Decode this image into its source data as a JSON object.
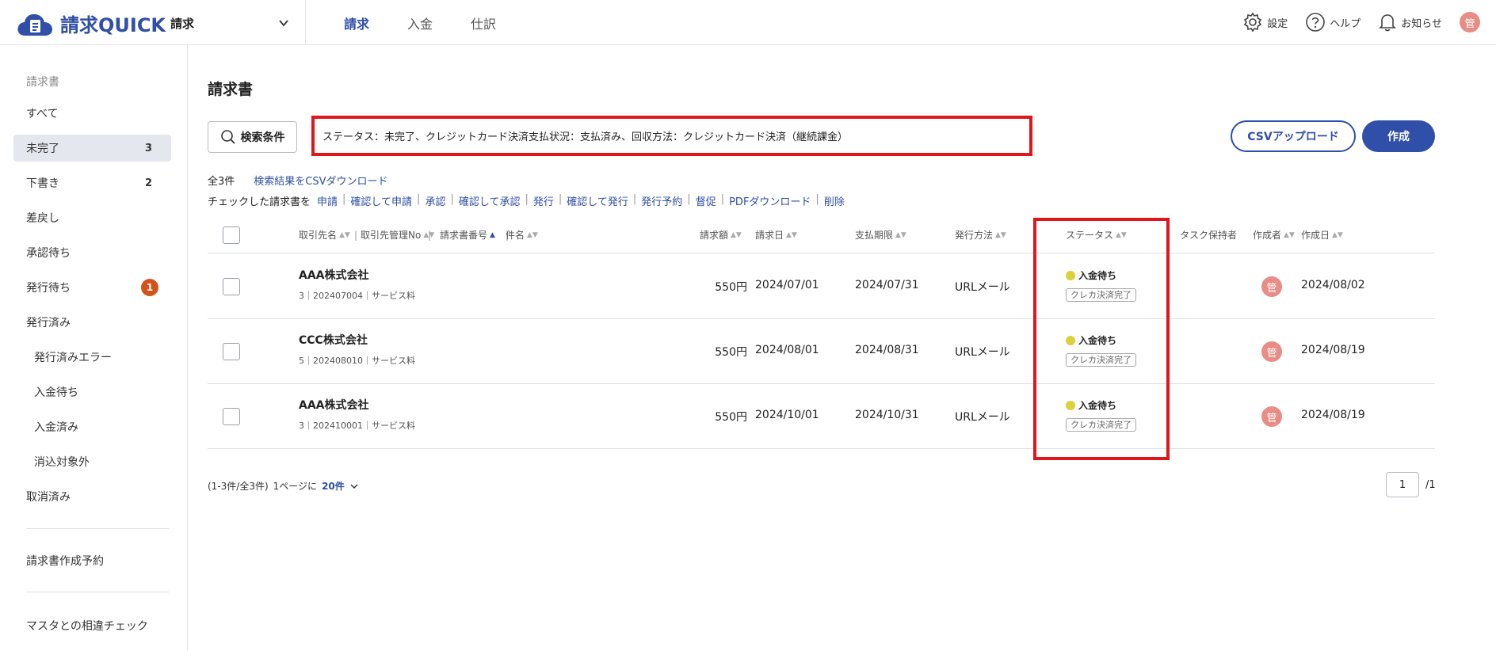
{
  "app": {
    "name": "請求QUICK",
    "module": "請求"
  },
  "top_nav": [
    "請求",
    "入金",
    "仕訳"
  ],
  "top_right": {
    "settings": "設定",
    "help": "ヘルプ",
    "notice": "お知らせ",
    "user_initial": "管"
  },
  "sidebar": {
    "heading": "請求書",
    "items": [
      {
        "label": "すべて"
      },
      {
        "label": "未完了",
        "count": "3"
      },
      {
        "label": "下書き",
        "count": "2"
      },
      {
        "label": "差戻し"
      },
      {
        "label": "承認待ち"
      },
      {
        "label": "発行待ち",
        "badge": "1"
      },
      {
        "label": "発行済み"
      },
      {
        "label": "発行済みエラー"
      },
      {
        "label": "入金待ち"
      },
      {
        "label": "入金済み"
      },
      {
        "label": "消込対象外"
      },
      {
        "label": "取消済み"
      }
    ],
    "extra1": "請求書作成予約",
    "extra2": "マスタとの相違チェック"
  },
  "main": {
    "title": "請求書",
    "search_label": "検索条件",
    "condition": "ステータス：未完了、クレジットカード決済支払状況：支払済み、回収方法：クレジットカード決済（継続課金）",
    "csv_upload": "CSVアップロード",
    "create": "作成",
    "total": "全3件",
    "csv_download": "検索結果をCSVダウンロード",
    "checked_prefix": "チェックした請求書を",
    "actions": [
      "申請",
      "確認して申請",
      "承認",
      "確認して承認",
      "発行",
      "確認して発行",
      "発行予約",
      "督促",
      "PDFダウンロード",
      "削除"
    ]
  },
  "table": {
    "headers": {
      "client": "取引先名",
      "client_no": "取引先管理No",
      "invoice_no": "請求書番号",
      "subject": "件名",
      "amount": "請求額",
      "date": "請求日",
      "due": "支払期限",
      "method": "発行方法",
      "status": "ステータス",
      "task": "タスク保持者",
      "creator": "作成者",
      "created": "作成日"
    },
    "rows": [
      {
        "client": "AAA株式会社",
        "sub": "3｜202407004｜サービス料",
        "amount": "550円",
        "date": "2024/07/01",
        "due": "2024/07/31",
        "method": "URLメール",
        "status": "入金待ち",
        "tag": "クレカ決済完了",
        "creator": "管",
        "created": "2024/08/02"
      },
      {
        "client": "CCC株式会社",
        "sub": "5｜202408010｜サービス料",
        "amount": "550円",
        "date": "2024/08/01",
        "due": "2024/08/31",
        "method": "URLメール",
        "status": "入金待ち",
        "tag": "クレカ決済完了",
        "creator": "管",
        "created": "2024/08/19"
      },
      {
        "client": "AAA株式会社",
        "sub": "3｜202410001｜サービス料",
        "amount": "550円",
        "date": "2024/10/01",
        "due": "2024/10/31",
        "method": "URLメール",
        "status": "入金待ち",
        "tag": "クレカ決済完了",
        "creator": "管",
        "created": "2024/08/19"
      }
    ]
  },
  "footer": {
    "range": "(1-3件/全3件)",
    "per_page_label": "1ページに",
    "per_page": "20件",
    "page": "1",
    "total_pages": "/1"
  }
}
